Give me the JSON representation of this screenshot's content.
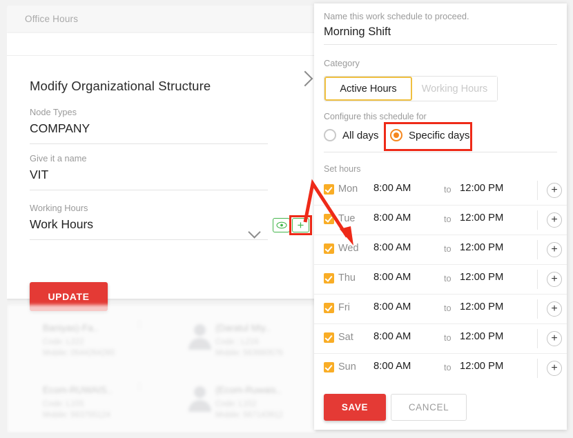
{
  "left_panel": {
    "tab_label": "Office Hours",
    "page_title": "Modify Organizational Structure",
    "fields": [
      {
        "label": "Node Types",
        "value": "COMPANY"
      },
      {
        "label": "Give it a name",
        "value": "VIT"
      },
      {
        "label": "Working Hours",
        "value": "Work Hours"
      }
    ],
    "update_button": "UPDATE",
    "icons": {
      "eye": "eye-icon",
      "plus": "+",
      "chevron_right": "chevron-right-icon",
      "select_caret": "chevron-down-icon"
    },
    "contacts": [
      {
        "name": "Baniyas)-Fa..",
        "code": "Code: L222",
        "mobile": "Mobile: 0544264280",
        "menu": "⋮"
      },
      {
        "name": "(Daratul Miy..",
        "code": "Code : L216",
        "mobile": "Mobile: 563660576",
        "menu": ""
      },
      {
        "name": "Ecom-RUWAIS..",
        "code": "Code: L155",
        "mobile": "Mobile: 563755124",
        "menu": "⋮"
      },
      {
        "name": "(Ecom-Ruwais..",
        "code": "Code: L152",
        "mobile": "Mobile: 567143912",
        "menu": ""
      }
    ]
  },
  "right_panel": {
    "name_label": "Name this work schedule to proceed.",
    "name_value": "Morning Shift",
    "category_label": "Category",
    "category_options": [
      {
        "label": "Active Hours",
        "selected": true
      },
      {
        "label": "Working Hours",
        "selected": false
      }
    ],
    "configure_label": "Configure this schedule for",
    "scope_options": [
      {
        "label": "All days",
        "selected": false
      },
      {
        "label": "Specific days",
        "selected": true
      }
    ],
    "set_hours_label": "Set hours",
    "to_label": "to",
    "add_icon": "+",
    "days": [
      {
        "day": "Mon",
        "checked": true,
        "start": "8:00 AM",
        "end": "12:00 PM"
      },
      {
        "day": "Tue",
        "checked": true,
        "start": "8:00 AM",
        "end": "12:00 PM"
      },
      {
        "day": "Wed",
        "checked": true,
        "start": "8:00 AM",
        "end": "12:00 PM"
      },
      {
        "day": "Thu",
        "checked": true,
        "start": "8:00 AM",
        "end": "12:00 PM"
      },
      {
        "day": "Fri",
        "checked": true,
        "start": "8:00 AM",
        "end": "12:00 PM"
      },
      {
        "day": "Sat",
        "checked": true,
        "start": "8:00 AM",
        "end": "12:00 PM"
      },
      {
        "day": "Sun",
        "checked": true,
        "start": "8:00 AM",
        "end": "12:00 PM"
      }
    ],
    "save_button": "SAVE",
    "cancel_button": "CANCEL"
  },
  "annotations": {
    "highlight_color": "#ee2a18",
    "arrow_color": "#ee2a18",
    "targets": [
      "add-working-hours-button",
      "specific-days-radio",
      "wed-day-row"
    ]
  },
  "colors": {
    "primary_red": "#e43a35",
    "accent_orange": "#f5871f",
    "checkbox_amber": "#f9ad26",
    "tab_border_yellow": "#f0c040",
    "green_outline": "#43b54a",
    "annotation_red": "#ee2a18",
    "page_background": "#f2f2f2"
  }
}
